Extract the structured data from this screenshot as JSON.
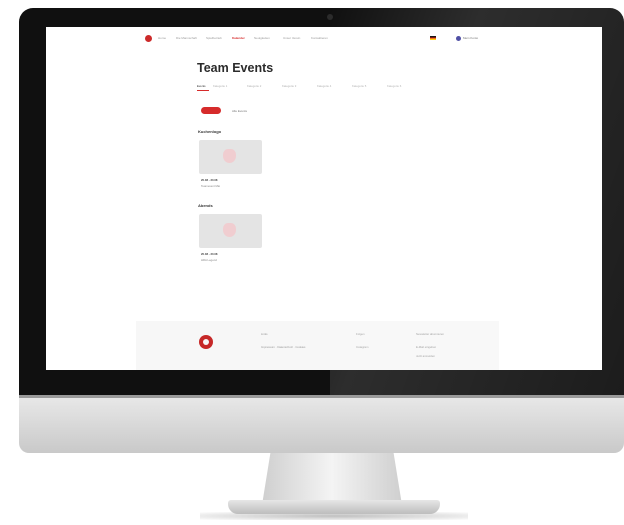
{
  "nav": {
    "items": [
      "Home",
      "Die Mannschaft",
      "Spielbetrieb",
      "Kalender",
      "Neuigkeiten",
      "Unser Verein",
      "Kontaktieren"
    ],
    "active_index": 3,
    "account_label": "Mein Konto"
  },
  "page": {
    "title": "Team Events"
  },
  "tabs": {
    "items": [
      "Events",
      "Kategorie 1",
      "Kategorie 2",
      "Kategorie 3",
      "Kategorie 4",
      "Kategorie 5",
      "Kategorie 6"
    ],
    "active_index": 0
  },
  "filters": {
    "secondary_label": "Alle Events"
  },
  "sections": [
    {
      "heading": "Kuchenlogo",
      "event": {
        "date": "20.08 - 20.08",
        "subtitle": "Teamevent Mai"
      }
    },
    {
      "heading": "Abends",
      "event": {
        "date": "20.08 - 20.08",
        "subtitle": "HRA Legend"
      }
    }
  ],
  "footer": {
    "col1_label": "Links",
    "col1_text": "Impressum · Datenschutz · Cookies",
    "col2_label": "Folgen",
    "col2_text": "Instagram",
    "col3_label": "Newsletter abonnieren",
    "col3_line1": "E-Mail eingeben",
    "col3_line2": "Jetzt anmelden"
  },
  "colors": {
    "accent": "#d62b2b",
    "bezel": "#101010",
    "card": "#e4e4e4"
  }
}
